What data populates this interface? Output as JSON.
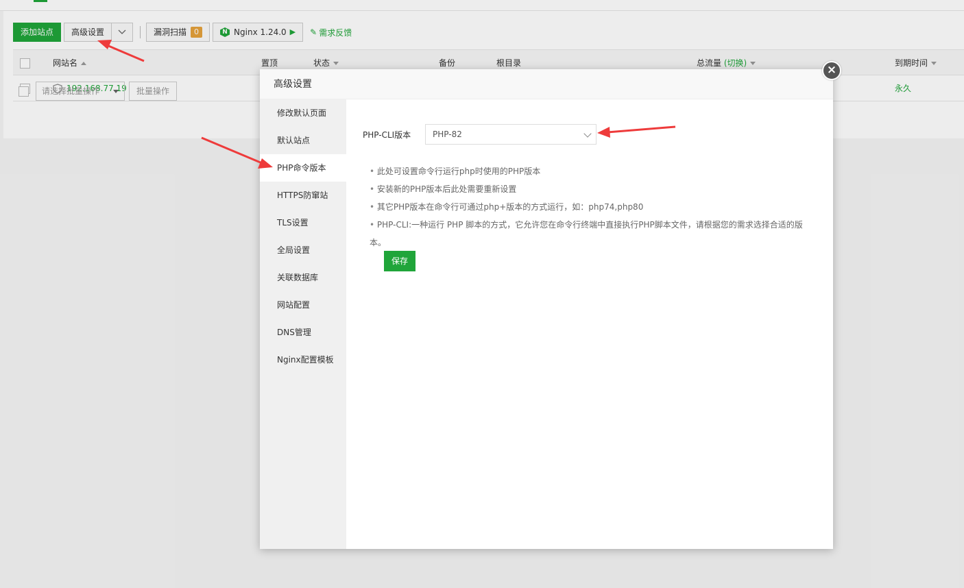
{
  "toolbar": {
    "add_site": "添加站点",
    "advanced": "高级设置",
    "vuln_scan": "漏洞扫描",
    "vuln_count": "0",
    "nginx": "Nginx 1.24.0",
    "feedback": "需求反馈"
  },
  "table": {
    "headers": {
      "site_name": "网站名",
      "top": "置顶",
      "status": "状态",
      "backup": "备份",
      "root": "根目录",
      "traffic": "总流量",
      "traffic_switch": "(切换)",
      "expire": "到期时间"
    },
    "rows": [
      {
        "site": "192.168.77.19",
        "expire": "永久"
      }
    ]
  },
  "bottom": {
    "batch_select": "请选择批量操作",
    "batch_btn": "批量操作"
  },
  "modal": {
    "title": "高级设置",
    "close": "×",
    "sidebar": [
      "修改默认页面",
      "默认站点",
      "PHP命令版本",
      "HTTPS防窜站",
      "TLS设置",
      "全局设置",
      "关联数据库",
      "网站配置",
      "DNS管理",
      "Nginx配置模板"
    ],
    "active_index": 2,
    "form": {
      "label": "PHP-CLI版本",
      "value": "PHP-82"
    },
    "tips": [
      "此处可设置命令行运行php时使用的PHP版本",
      "安装新的PHP版本后此处需要重新设置",
      "其它PHP版本在命令行可通过php+版本的方式运行，如：php74,php80",
      "PHP-CLI:一种运行 PHP 脚本的方式，它允许您在命令行终端中直接执行PHP脚本文件，请根据您的需求选择合适的版本。"
    ],
    "save": "保存"
  },
  "colors": {
    "accent": "#20a53a",
    "badge": "#e6a23c",
    "annotation_arrow": "#ee3b3b"
  }
}
